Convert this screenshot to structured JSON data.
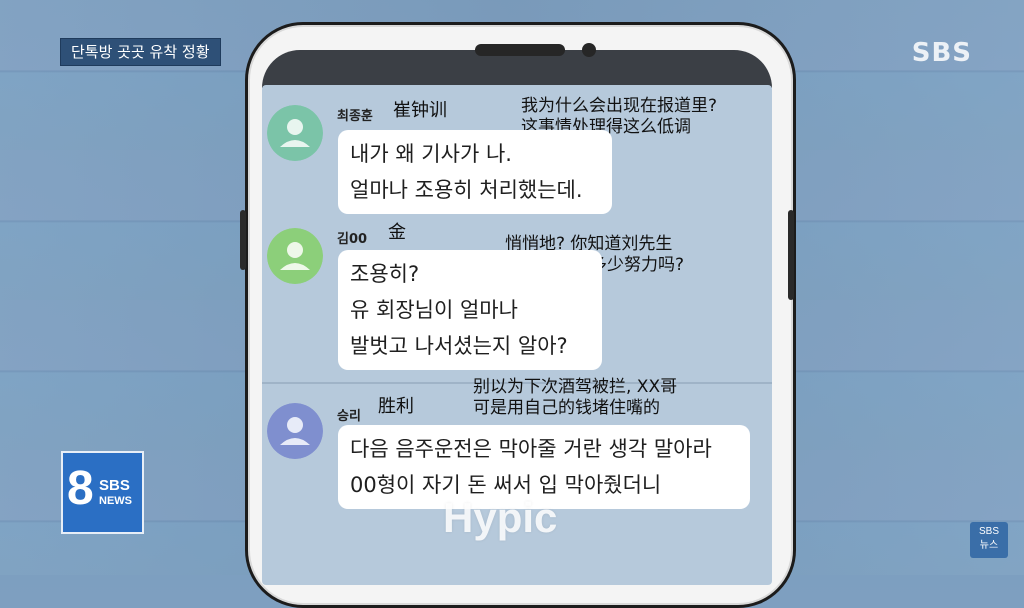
{
  "broadcast": {
    "headline": "단톡방 곳곳 유착 정황",
    "channel_logo": "SBS",
    "corner_logo": {
      "number": "8",
      "line1": "SBS",
      "line2": "NEWS"
    },
    "bottom_logo": {
      "line1": "SBS",
      "line2": "뉴스"
    },
    "watermark": "Hypic"
  },
  "chat": {
    "messages": [
      {
        "sender": "최종훈",
        "sender_translation": "崔钟训",
        "lines": [
          "내가 왜 기사가 나.",
          "얼마나 조용히 처리했는데."
        ],
        "translation_lines": [
          "我为什么会出现在报道里?",
          "这事情处理得这么低调"
        ],
        "avatar_color": "#7bc4a8"
      },
      {
        "sender": "김00",
        "sender_translation": "金",
        "lines": [
          "조용히?",
          "유 회장님이 얼마나",
          "발벗고 나서셨는지 알아?"
        ],
        "translation_lines": [
          "悄悄地? 你知道刘先生",
          "为了你做了多少努力吗?"
        ],
        "avatar_color": "#8ccf7a"
      },
      {
        "sender": "승리",
        "sender_translation": "胜利",
        "lines": [
          "다음 음주운전은 막아줄 거란 생각 말아라",
          "00형이 자기 돈 써서 입 막아줬더니"
        ],
        "translation_lines": [
          "别以为下次酒驾被拦, XX哥",
          "可是用自己的钱堵住嘴的"
        ],
        "avatar_color": "#7f8fcf"
      }
    ]
  }
}
